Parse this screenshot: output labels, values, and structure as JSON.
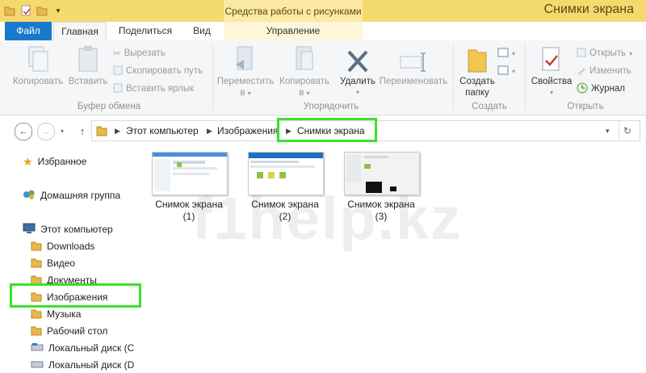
{
  "window": {
    "title": "Снимки экрана",
    "context_group": "Средства работы с рисунками"
  },
  "tabs": {
    "file": "Файл",
    "home": "Главная",
    "share": "Поделиться",
    "view": "Вид",
    "manage": "Управление"
  },
  "ribbon": {
    "clipboard": {
      "label": "Буфер обмена",
      "copy": "Копировать",
      "paste": "Вставить",
      "cut": "Вырезать",
      "copy_path": "Скопировать путь",
      "paste_shortcut": "Вставить ярлык"
    },
    "organize": {
      "label": "Упорядочить",
      "move_to_1": "Переместить",
      "move_to_2": "в",
      "copy_to_1": "Копировать",
      "copy_to_2": "в",
      "delete": "Удалить",
      "rename": "Переименовать"
    },
    "new": {
      "label": "Создать",
      "new_folder_1": "Создать",
      "new_folder_2": "папку"
    },
    "open": {
      "label": "Открыть",
      "properties": "Свойства",
      "open": "Открыть",
      "edit": "Изменить",
      "history": "Журнал"
    }
  },
  "address": {
    "crumbs": [
      "Этот компьютер",
      "Изображения",
      "Снимки экрана"
    ]
  },
  "navpane": {
    "favorites": "Избранное",
    "homegroup": "Домашняя группа",
    "this_pc": "Этот компьютер",
    "items": [
      "Downloads",
      "Видео",
      "Документы",
      "Изображения",
      "Музыка",
      "Рабочий стол",
      "Локальный диск (C",
      "Локальный диск (D"
    ]
  },
  "files": [
    {
      "line1": "Снимок экрана",
      "line2": "(1)"
    },
    {
      "line1": "Снимок экрана",
      "line2": "(2)"
    },
    {
      "line1": "Снимок экрана",
      "line2": "(3)"
    }
  ],
  "watermark": "f1help.kz",
  "colors": {
    "titlebar": "#f4d96e",
    "file_tab": "#1979ca",
    "highlight": "#3de02c"
  }
}
